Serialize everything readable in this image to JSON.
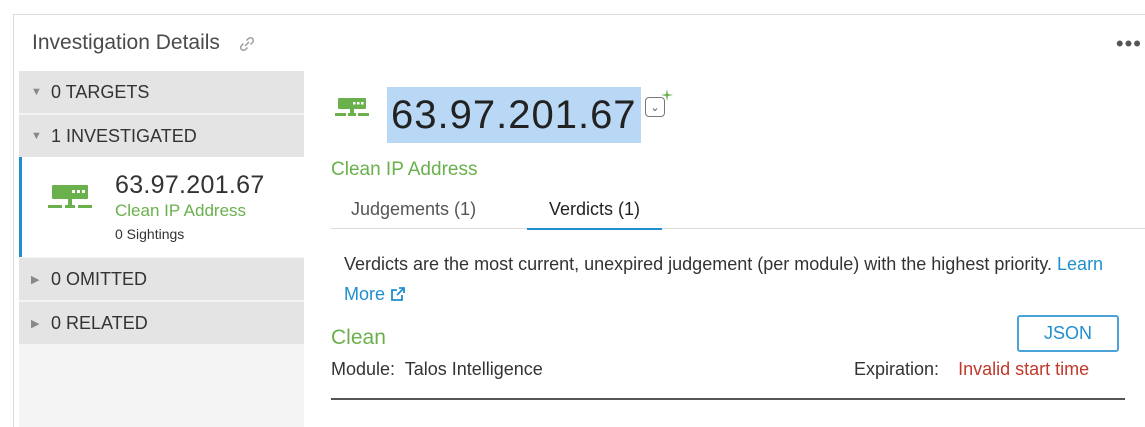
{
  "header": {
    "title": "Investigation Details",
    "more_label": "•••"
  },
  "sidebar": {
    "targets_label": "0 TARGETS",
    "investigated_label": "1 INVESTIGATED",
    "investigated_item": {
      "ip": "63.97.201.67",
      "status": "Clean IP Address",
      "sightings": "0 Sightings"
    },
    "omitted_label": "0 OMITTED",
    "related_label": "0 RELATED"
  },
  "main": {
    "observable": "63.97.201.67",
    "observable_status": "Clean IP Address",
    "tabs": [
      {
        "label": "Judgements (1)",
        "active": false
      },
      {
        "label": "Verdicts (1)",
        "active": true
      }
    ],
    "description": "Verdicts are the most current, unexpired judgement (per module) with the highest priority.",
    "learn_more_label": "Learn More",
    "verdict": {
      "status": "Clean",
      "json_button_label": "JSON",
      "module_label": "Module:",
      "module_value": "Talos Intelligence",
      "expiration_label": "Expiration:",
      "expiration_value": "Invalid start time"
    }
  },
  "colors": {
    "accent": "#1f8fce",
    "clean": "#6ab04c",
    "highlight": "#b8d8f5",
    "error": "#c0392b"
  },
  "icons": [
    "link-icon",
    "more-icon",
    "chevron-down-icon",
    "chevron-right-icon",
    "ip-address-icon",
    "dropdown-chevron-icon",
    "sparkle-icon",
    "external-link-icon"
  ]
}
